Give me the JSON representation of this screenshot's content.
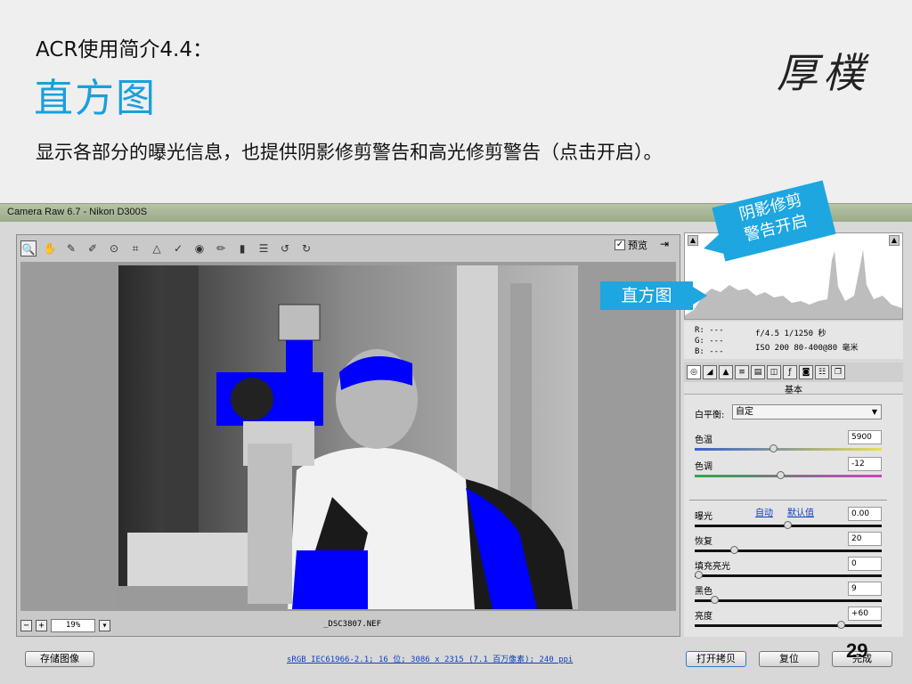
{
  "slide": {
    "subtitle": "ACR使用简介4.4：",
    "title": "直方图",
    "description": "显示各部分的曝光信息，也提供阴影修剪警告和高光修剪警告（点击开启）。",
    "logo": "厚樸",
    "page_number": "29"
  },
  "window": {
    "title": "Camera Raw 6.7 -  Nikon D300S"
  },
  "toolbar": {
    "preview_label": "预览",
    "preview_checked": "✓",
    "tools": [
      {
        "name": "zoom-tool-icon",
        "glyph": "🔍"
      },
      {
        "name": "hand-tool-icon",
        "glyph": "✋"
      },
      {
        "name": "white-balance-tool-icon",
        "glyph": "✎"
      },
      {
        "name": "color-sampler-tool-icon",
        "glyph": "✐"
      },
      {
        "name": "targeted-adjustment-tool-icon",
        "glyph": "⊙"
      },
      {
        "name": "crop-tool-icon",
        "glyph": "⌗"
      },
      {
        "name": "straighten-tool-icon",
        "glyph": "△"
      },
      {
        "name": "spot-removal-tool-icon",
        "glyph": "✓"
      },
      {
        "name": "red-eye-tool-icon",
        "glyph": "◉"
      },
      {
        "name": "adjustment-brush-icon",
        "glyph": "✏"
      },
      {
        "name": "graduated-filter-icon",
        "glyph": "▮"
      },
      {
        "name": "preferences-icon",
        "glyph": "☰"
      },
      {
        "name": "rotate-left-icon",
        "glyph": "↺"
      },
      {
        "name": "rotate-right-icon",
        "glyph": "↻"
      }
    ]
  },
  "status": {
    "zoom": "19%",
    "filename": "_DSC3807.NEF"
  },
  "info": {
    "r": "R:  ---",
    "g": "G:  ---",
    "b": "B:  ---",
    "aperture_shutter": "f/4.5  1/1250 秒",
    "iso_lens": "ISO 200  80-400@80 毫米"
  },
  "panel": {
    "header": "基本",
    "wb_label": "白平衡:",
    "wb_value": "自定",
    "auto_link": "自动",
    "default_link": "默认值",
    "rows": [
      {
        "label": "色温",
        "value": "5900",
        "pos": 0.42
      },
      {
        "label": "色调",
        "value": "-12",
        "pos": 0.46
      },
      {
        "label": "曝光",
        "value": "0.00",
        "pos": 0.5
      },
      {
        "label": "恢复",
        "value": "20",
        "pos": 0.2
      },
      {
        "label": "填充亮光",
        "value": "0",
        "pos": 0.0
      },
      {
        "label": "黑色",
        "value": "9",
        "pos": 0.09
      },
      {
        "label": "亮度",
        "value": "+60",
        "pos": 0.8
      }
    ]
  },
  "bottom": {
    "save_label": "存储图像",
    "workflow": "sRGB IEC61966-2.1; 16 位; 3086 x 2315 (7.1 百万像素); 240 ppi",
    "open_label": "打开拷贝",
    "reset_label": "复位",
    "done_label": "完成"
  },
  "callouts": {
    "shadow_warning_line1": "阴影修剪",
    "shadow_warning_line2": "警告开启",
    "histogram": "直方图"
  },
  "colors": {
    "accent": "#1ea6e0",
    "clip_warning": "#0000ff"
  }
}
